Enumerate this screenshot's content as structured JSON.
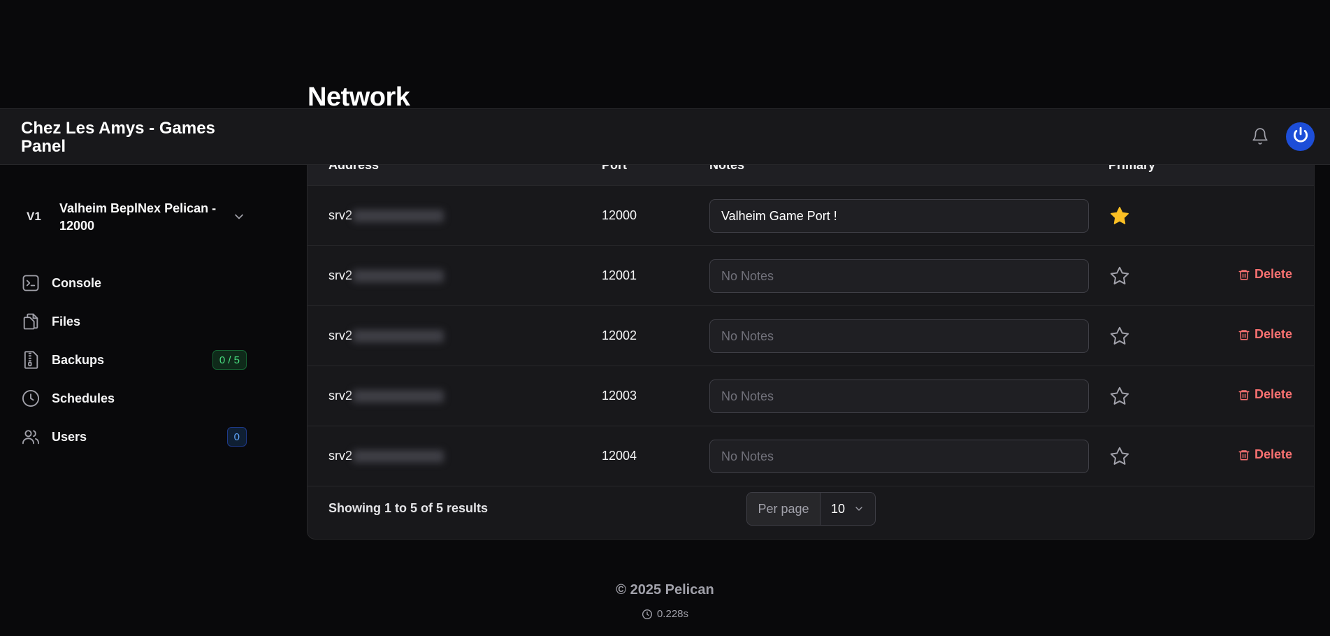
{
  "page": {
    "title": "Network"
  },
  "topbar": {
    "brand": "Chez Les Amys - Games Panel",
    "bell_icon": "bell-icon",
    "avatar_icon": "power-icon"
  },
  "sidebar": {
    "server": {
      "badge": "V1",
      "name": "Valheim BeplNex Pelican - 12000"
    },
    "items": [
      {
        "label": "Console",
        "icon": "terminal-icon"
      },
      {
        "label": "Files",
        "icon": "files-icon"
      },
      {
        "label": "Backups",
        "icon": "archive-icon",
        "badge": "0 / 5"
      },
      {
        "label": "Schedules",
        "icon": "clock-icon"
      },
      {
        "label": "Users",
        "icon": "users-icon",
        "badge": "0"
      }
    ]
  },
  "table": {
    "headers": {
      "address": "Address",
      "port": "Port",
      "notes": "Notes",
      "primary": "Primary"
    },
    "rows": [
      {
        "address": "srv2",
        "port": "12000",
        "notes": "Valheim Game Port !",
        "primary": true
      },
      {
        "address": "srv2",
        "port": "12001",
        "notes": "",
        "primary": false,
        "delete": "Delete"
      },
      {
        "address": "srv2",
        "port": "12002",
        "notes": "",
        "primary": false,
        "delete": "Delete"
      },
      {
        "address": "srv2",
        "port": "12003",
        "notes": "",
        "primary": false,
        "delete": "Delete"
      },
      {
        "address": "srv2",
        "port": "12004",
        "notes": "",
        "primary": false,
        "delete": "Delete"
      }
    ],
    "notes_placeholder": "No Notes",
    "footer": {
      "showing": "Showing 1 to 5 of 5 results",
      "per_page_label": "Per page",
      "per_page_value": "10"
    }
  },
  "colors": {
    "accent": "#1d4ed8",
    "danger": "#f87171",
    "star": "#fbbf24"
  },
  "footer": {
    "copyright": "© 2025 Pelican",
    "time": "0.228s"
  }
}
